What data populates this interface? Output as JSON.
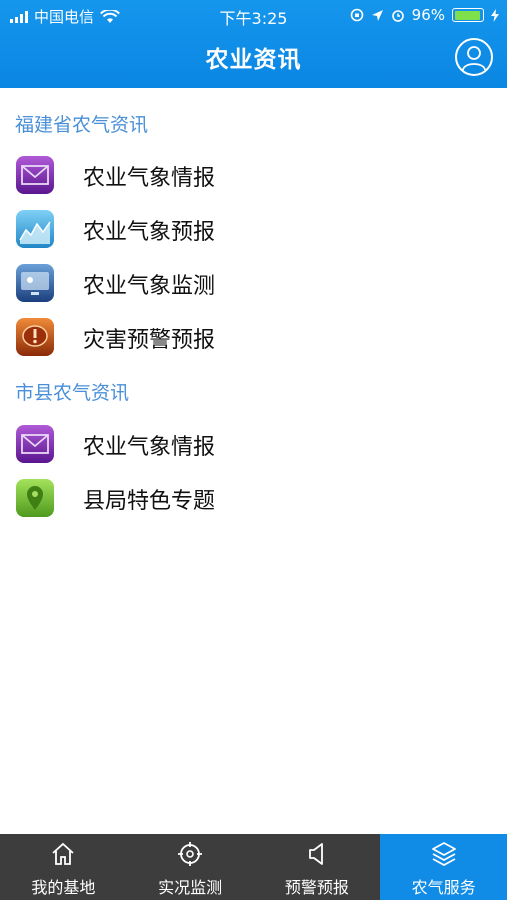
{
  "status_bar": {
    "carrier": "中国电信",
    "time": "下午3:25",
    "battery": "96%",
    "battery_level": 0.96
  },
  "header": {
    "title": "农业资讯",
    "user_icon": "user-circle-icon"
  },
  "sections": [
    {
      "title": "福建省农气资讯",
      "items": [
        {
          "label": "农业气象情报",
          "icon": "mail-icon"
        },
        {
          "label": "农业气象预报",
          "icon": "chart-icon"
        },
        {
          "label": "农业气象监测",
          "icon": "monitor-icon"
        },
        {
          "label": "灾害预警预报",
          "icon": "warning-icon"
        }
      ]
    },
    {
      "title": "市县农气资讯",
      "items": [
        {
          "label": "农业气象情报",
          "icon": "mail-icon"
        },
        {
          "label": "县局特色专题",
          "icon": "location-pin-icon"
        }
      ]
    }
  ],
  "tabbar": {
    "tabs": [
      {
        "label": "我的基地",
        "icon": "home-icon",
        "active": false
      },
      {
        "label": "实况监测",
        "icon": "target-icon",
        "active": false
      },
      {
        "label": "预警预报",
        "icon": "speaker-icon",
        "active": false
      },
      {
        "label": "农气服务",
        "icon": "layers-icon",
        "active": true
      }
    ],
    "active_color": "#118ce6"
  }
}
